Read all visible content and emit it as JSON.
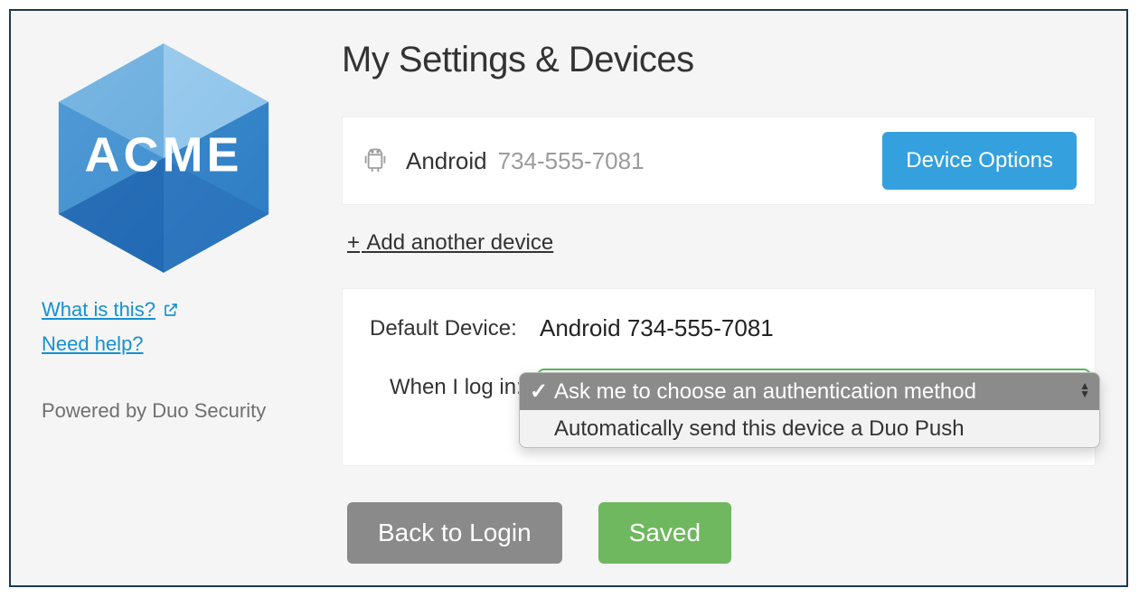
{
  "sidebar": {
    "logo_text": "ACME",
    "what_is_this": "What is this?",
    "need_help": "Need help?",
    "powered": "Powered by Duo Security"
  },
  "page": {
    "title": "My Settings & Devices"
  },
  "device": {
    "type": "Android",
    "phone": "734-555-7081",
    "options_label": "Device Options"
  },
  "add_device": {
    "plus": "+",
    "label": "Add another device"
  },
  "settings": {
    "default_device_label": "Default Device:",
    "default_device_value": "Android 734-555-7081",
    "login_label": "When I log in:"
  },
  "dropdown": {
    "options": [
      "Ask me to choose an authentication method",
      "Automatically send this device a Duo Push"
    ],
    "selected_index": 0
  },
  "buttons": {
    "back": "Back to Login",
    "saved": "Saved"
  },
  "colors": {
    "accent_blue": "#34a0dd",
    "accent_green": "#6fb85f",
    "outline_green": "#5cb85c",
    "link": "#1691d0"
  }
}
